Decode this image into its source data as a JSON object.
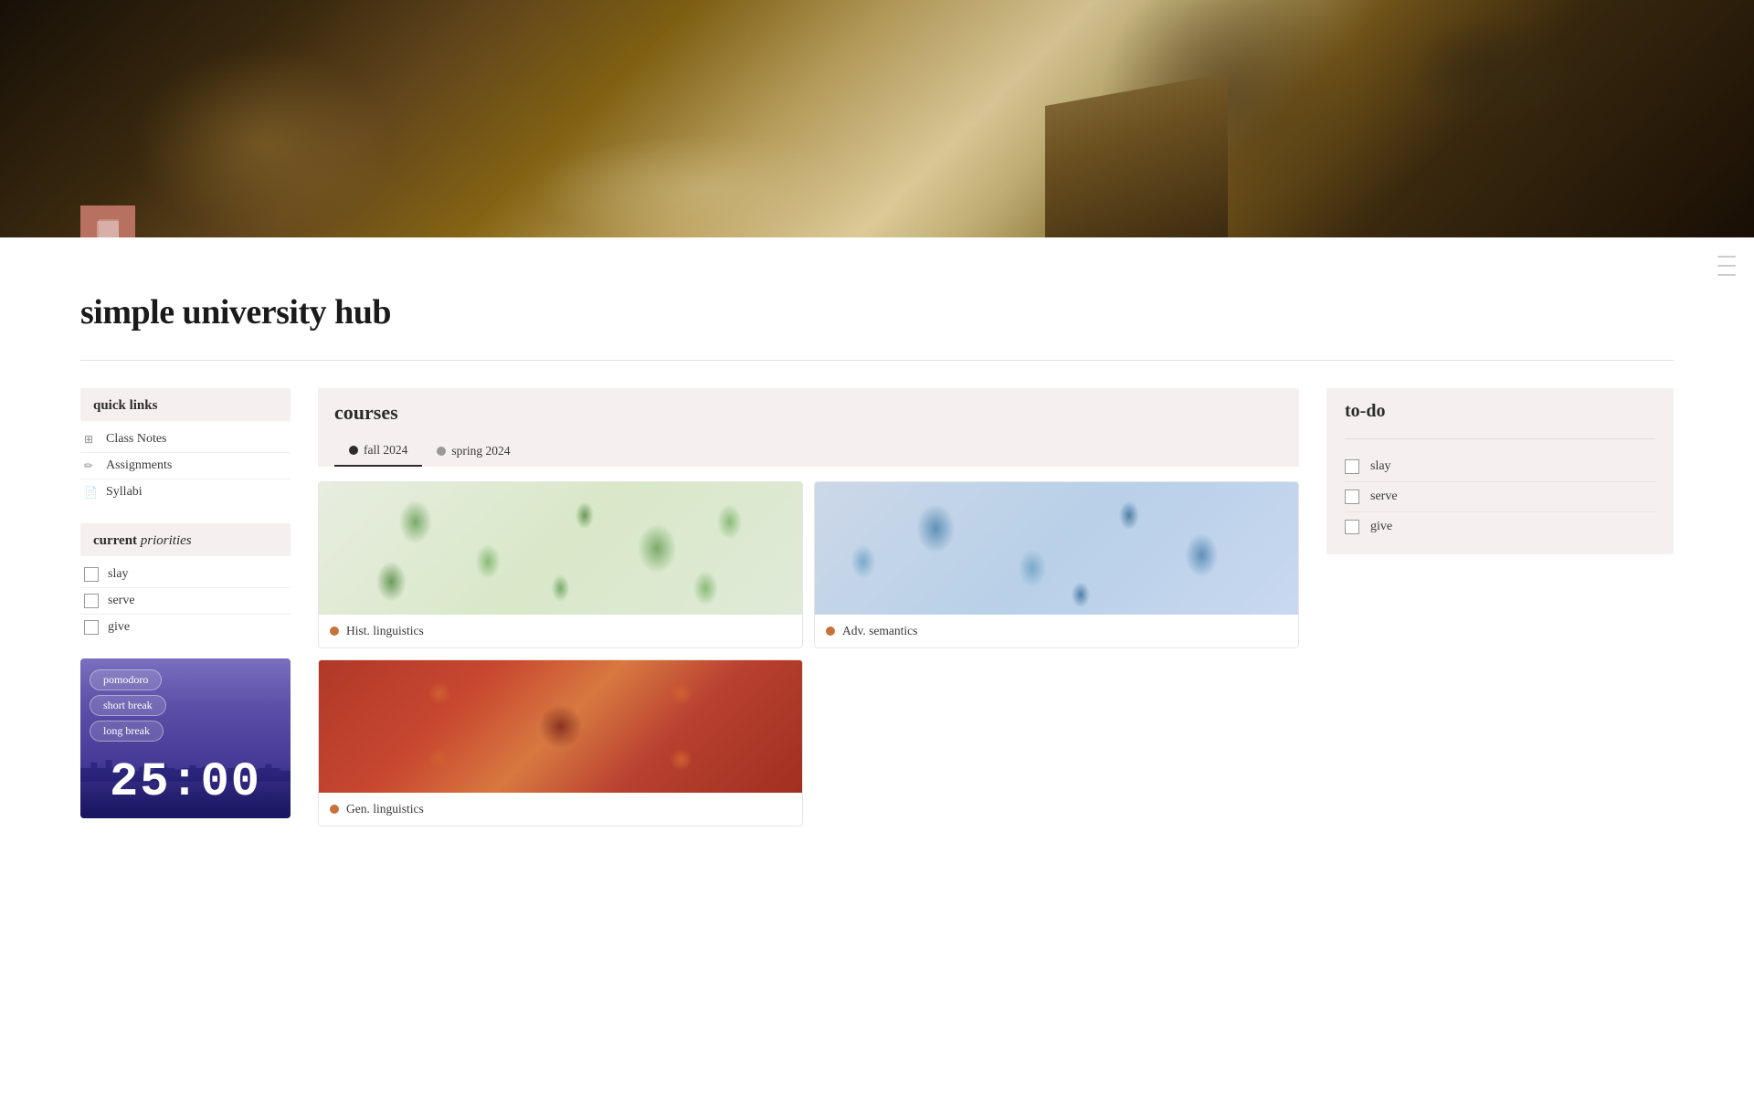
{
  "header": {
    "title": "simple university hub",
    "icon_alt": "notebook-icon"
  },
  "sidebar_controls": {
    "lines": [
      "line1",
      "line2",
      "line3"
    ]
  },
  "quick_links": {
    "section_title": "quick links",
    "links": [
      {
        "id": "class-notes",
        "label": "Class Notes",
        "icon": "⊞"
      },
      {
        "id": "assignments",
        "label": "Assignments",
        "icon": "✏"
      },
      {
        "id": "syllabi",
        "label": "Syllabi",
        "icon": "📄"
      }
    ]
  },
  "priorities": {
    "section_title_normal": "current",
    "section_title_italic": "priorities",
    "items": [
      {
        "id": "slay",
        "label": "slay",
        "checked": false
      },
      {
        "id": "serve",
        "label": "serve",
        "checked": false
      },
      {
        "id": "give",
        "label": "give",
        "checked": false
      }
    ]
  },
  "pomodoro": {
    "buttons": [
      {
        "id": "pomodoro-btn",
        "label": "pomodoro"
      },
      {
        "id": "short-break-btn",
        "label": "short break"
      },
      {
        "id": "long-break-btn",
        "label": "long break"
      }
    ],
    "timer": "25:00"
  },
  "courses": {
    "section_title": "courses",
    "tabs": [
      {
        "id": "fall-2024",
        "label": "fall 2024",
        "dot_style": "dark",
        "active": true
      },
      {
        "id": "spring-2024",
        "label": "spring 2024",
        "dot_style": "gray",
        "active": false
      }
    ],
    "cards": [
      {
        "id": "hist-linguistics",
        "label": "Hist. linguistics",
        "image_style": "green-floral",
        "dot_color": "orange"
      },
      {
        "id": "adv-semantics",
        "label": "Adv. semantics",
        "image_style": "blue-floral",
        "dot_color": "orange"
      },
      {
        "id": "gen-linguistics",
        "label": "Gen. linguistics",
        "image_style": "carpet-pattern",
        "dot_color": "orange"
      }
    ]
  },
  "todo": {
    "section_title": "to-do",
    "items": [
      {
        "id": "todo-slay",
        "label": "slay",
        "checked": false
      },
      {
        "id": "todo-serve",
        "label": "serve",
        "checked": false
      },
      {
        "id": "todo-give",
        "label": "give",
        "checked": false
      }
    ]
  }
}
